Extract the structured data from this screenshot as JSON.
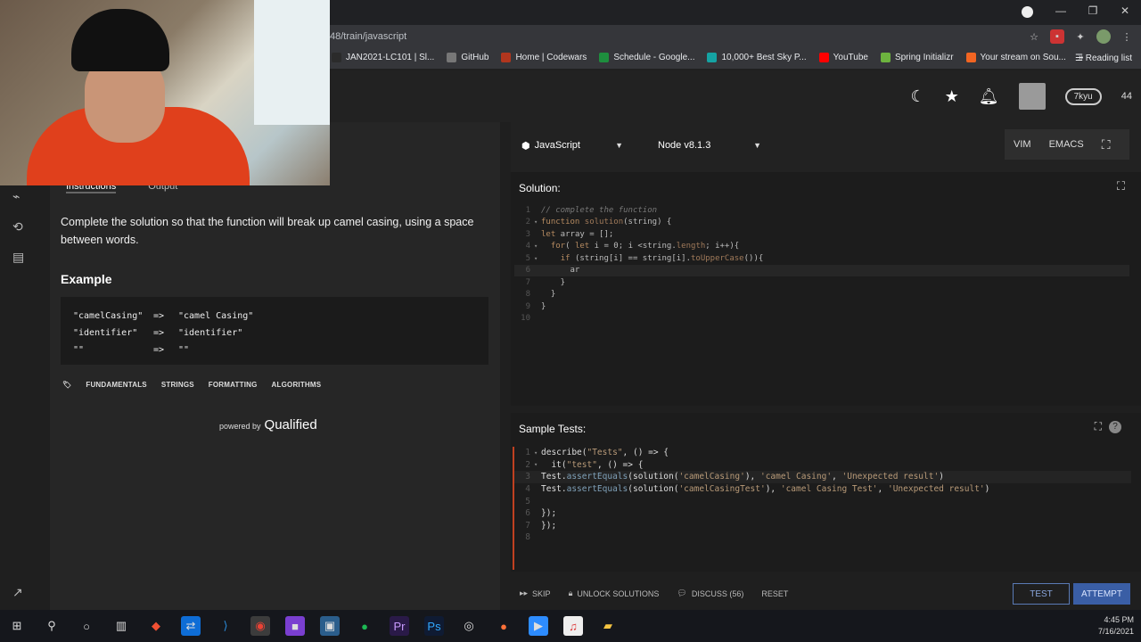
{
  "browser": {
    "url": "48/train/javascript",
    "bookmarks": [
      {
        "label": "JAN2021-LC101 | Sl...",
        "color": "#2b2b2b"
      },
      {
        "label": "GitHub",
        "color": "#777777"
      },
      {
        "label": "Home | Codewars",
        "color": "#b1361e"
      },
      {
        "label": "Schedule - Google...",
        "color": "#1e8e3e"
      },
      {
        "label": "10,000+ Best Sky P...",
        "color": "#15a3a3"
      },
      {
        "label": "YouTube",
        "color": "#ff0000"
      },
      {
        "label": "Spring Initializr",
        "color": "#6db33f"
      },
      {
        "label": "Your stream on Sou...",
        "color": "#f26522"
      }
    ],
    "overflow": "»",
    "reading_list": "Reading list"
  },
  "header": {
    "rank": "7kyu",
    "honor": "44"
  },
  "left": {
    "tabs": [
      "Instructions",
      "Output"
    ],
    "description": "Complete the solution so that the function will break up camel casing, using a space between words.",
    "example_title": "Example",
    "examples": [
      {
        "input": "\"camelCasing\"",
        "arrow": "=>",
        "output": "\"camel Casing\""
      },
      {
        "input": "\"identifier\"",
        "arrow": "=>",
        "output": "\"identifier\""
      },
      {
        "input": "\"\"",
        "arrow": "=>",
        "output": "\"\""
      }
    ],
    "tags": [
      "FUNDAMENTALS",
      "STRINGS",
      "FORMATTING",
      "ALGORITHMS"
    ],
    "powered_by": "powered by",
    "brand": "Qualified"
  },
  "toolbar": {
    "language": "JavaScript",
    "version": "Node v8.1.3",
    "vim": "VIM",
    "emacs": "EMACS"
  },
  "solution": {
    "title": "Solution:",
    "lines": [
      "// complete the function",
      "function solution(string) {",
      "let array = [];",
      "  for( let i = 0; i <string.length; i++){",
      "    if (string[i] == string[i].toUpperCase()){",
      "      ar",
      "    }",
      "  }",
      "}",
      ""
    ],
    "line_numbers": [
      "1",
      "2",
      "3",
      "4",
      "5",
      "6",
      "7",
      "8",
      "9",
      "10"
    ]
  },
  "tests": {
    "title": "Sample Tests:",
    "lines": [
      "describe(\"Tests\", () => {",
      "  it(\"test\", () => {",
      "Test.assertEquals(solution('camelCasing'), 'camel Casing', 'Unexpected result')",
      "Test.assertEquals(solution('camelCasingTest'), 'camel Casing Test', 'Unexpected result')",
      "",
      "});",
      "});",
      ""
    ],
    "line_numbers": [
      "1",
      "2",
      "3",
      "4",
      "5",
      "6",
      "7",
      "8"
    ]
  },
  "bottom": {
    "skip": "SKIP",
    "unlock": "UNLOCK SOLUTIONS",
    "discuss": "DISCUSS (56)",
    "reset": "RESET",
    "test": "TEST",
    "attempt": "ATTEMPT"
  },
  "taskbar": {
    "time": "4:45 PM",
    "date": "7/16/2021"
  }
}
